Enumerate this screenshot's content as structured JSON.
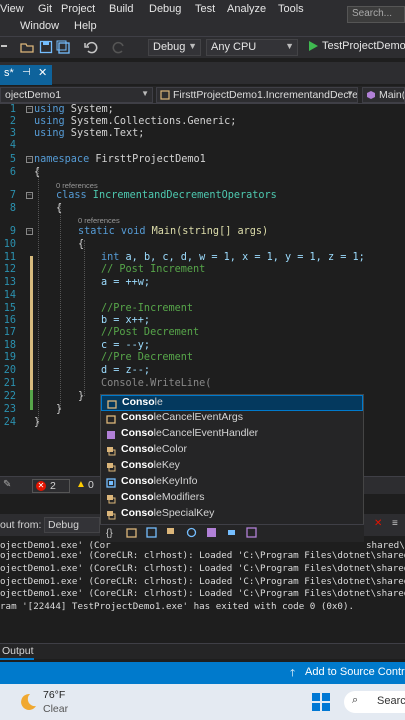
{
  "menubar": {
    "items_row1": [
      "View",
      "Git",
      "Project",
      "Build",
      "Debug",
      "Test",
      "Analyze",
      "Tools"
    ],
    "items_row2": [
      "Window",
      "Help"
    ],
    "search_placeholder": "Search..."
  },
  "toolbar": {
    "config": "Debug",
    "platform": "Any CPU",
    "run_target": "TestProjectDemo1"
  },
  "tab": {
    "label": "s*"
  },
  "navbar": {
    "project": "ojectDemo1",
    "class": "FirsttProjectDemo1.IncrementandDecre",
    "member": "Main(s"
  },
  "editor": {
    "lines": [
      {
        "n": "1",
        "c": "using",
        "c2": " System;"
      },
      {
        "n": "2",
        "c": "using",
        "c2": " System.Collections.Generic;"
      },
      {
        "n": "3",
        "c": "using",
        "c2": " System.Text;"
      },
      {
        "n": "4"
      },
      {
        "n": "5",
        "c": "namespace",
        "c2": " FirsttProjectDemo1"
      },
      {
        "n": "6",
        "c2": "{"
      },
      {
        "n": "7",
        "c": "class",
        "c2": " IncrementandDecrementOperators"
      },
      {
        "n": "8",
        "c2": "{"
      },
      {
        "n": "9",
        "c": "static void",
        "c2": " Main(string[] args)"
      },
      {
        "n": "10",
        "c2": "{"
      },
      {
        "n": "11",
        "c": "int",
        "c2": " a, b, c, d, w = 1, x = 1, y = 1, z = 1;"
      },
      {
        "n": "12",
        "c2": "// Post Increment"
      },
      {
        "n": "13",
        "c2": "a = ++w;"
      },
      {
        "n": "14"
      },
      {
        "n": "15",
        "c2": "//Pre-Increment"
      },
      {
        "n": "16",
        "c2": "b = x++;"
      },
      {
        "n": "17",
        "c2": "//Post Decrement"
      },
      {
        "n": "18",
        "c2": "c = --y;"
      },
      {
        "n": "19",
        "c2": "//Pre Decrement"
      },
      {
        "n": "20",
        "c2": "d = z--;"
      },
      {
        "n": "21",
        "c2": "Console.WriteLine("
      },
      {
        "n": "22",
        "c2": "}"
      },
      {
        "n": "23",
        "c2": "}"
      },
      {
        "n": "24",
        "c2": "}"
      }
    ],
    "refs_label": "0 references"
  },
  "intellisense": {
    "typed_prefix": "Conso",
    "items": [
      {
        "prefix": "Conso",
        "rest": "le",
        "kind": "class",
        "selected": true
      },
      {
        "prefix": "Conso",
        "rest": "leCancelEventArgs",
        "kind": "class"
      },
      {
        "prefix": "Conso",
        "rest": "leCancelEventHandler",
        "kind": "delegate"
      },
      {
        "prefix": "Conso",
        "rest": "leColor",
        "kind": "enum"
      },
      {
        "prefix": "Conso",
        "rest": "leKey",
        "kind": "enum"
      },
      {
        "prefix": "Conso",
        "rest": "leKeyInfo",
        "kind": "struct"
      },
      {
        "prefix": "Conso",
        "rest": "leModifiers",
        "kind": "enum"
      },
      {
        "prefix": "Conso",
        "rest": "leSpecialKey",
        "kind": "enum"
      }
    ]
  },
  "editor_status": {
    "errors": "2",
    "warnings": "0"
  },
  "output": {
    "show_from_label": "out from:",
    "show_from_value": "Debug",
    "lines": [
      "ojectDemo1.exe' (Cor",
      "ojectDemo1.exe' (CoreCLR: clrhost): Loaded 'C:\\Program Files\\dotnet\\shared\\M",
      "ojectDemo1.exe' (CoreCLR: clrhost): Loaded 'C:\\Program Files\\dotnet\\shared\\M",
      "ojectDemo1.exe' (CoreCLR: clrhost): Loaded 'C:\\Program Files\\dotnet\\shared\\M",
      "ojectDemo1.exe' (CoreCLR: clrhost): Loaded 'C:\\Program Files\\dotnet\\shared\\M",
      "ram '[22444] TestProjectDemo1.exe' has exited with code 0 (0x0)."
    ],
    "partial_right": "shared\\M",
    "tab_label": "Output"
  },
  "statusbar": {
    "source_control": "Add to Source Control"
  },
  "taskbar": {
    "temperature": "76°F",
    "weather": "Clear",
    "search": "Search"
  },
  "colors": {
    "accent": "#007acc",
    "selection": "#04395e"
  }
}
